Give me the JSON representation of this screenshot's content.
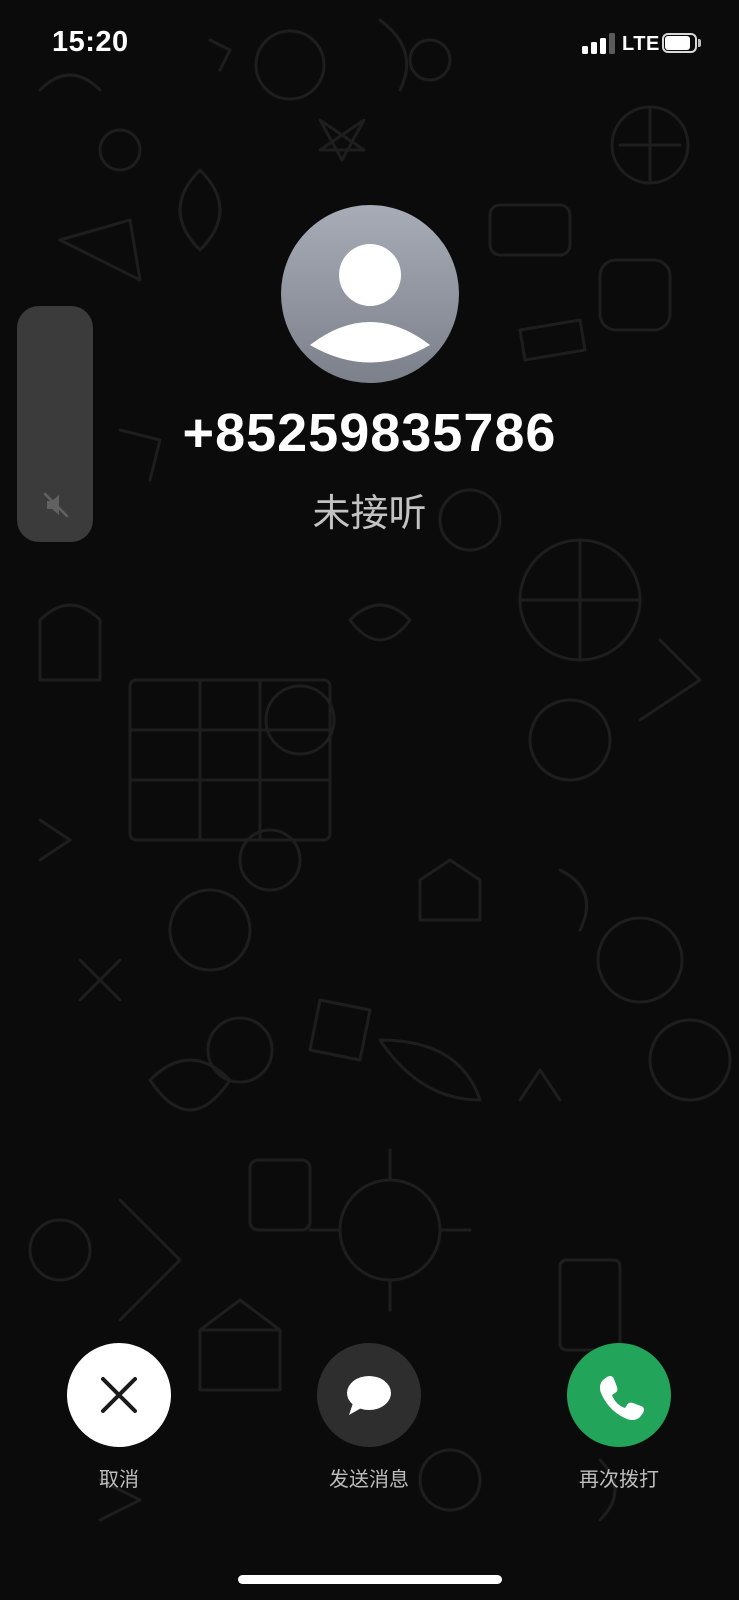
{
  "status_bar": {
    "time": "15:20",
    "network": "LTE",
    "signal_bars_filled": 3,
    "signal_bars_total": 4,
    "battery_level": 0.85
  },
  "volume_hud": {
    "state": "muted",
    "icon": "speaker-muted-icon"
  },
  "call": {
    "avatar_icon": "person-placeholder-icon",
    "number": "+85259835786",
    "status": "未接听"
  },
  "actions": [
    {
      "label": "取消",
      "icon": "close-icon",
      "color": "#FFFFFF"
    },
    {
      "label": "发送消息",
      "icon": "chat-bubble-icon",
      "color": "#2E2E2E"
    },
    {
      "label": "再次拨打",
      "icon": "phone-icon",
      "color": "#22A45A"
    }
  ],
  "colors": {
    "background": "#0B0B0B",
    "accent_green": "#22A45A"
  }
}
